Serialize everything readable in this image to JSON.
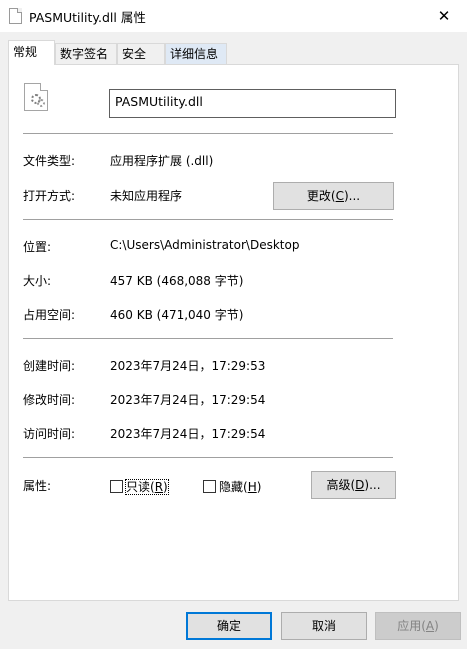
{
  "window": {
    "title": "PASMUtility.dll 属性",
    "close_glyph": "✕"
  },
  "tabs": [
    {
      "label": "常规",
      "active": true
    },
    {
      "label": "数字签名",
      "active": false
    },
    {
      "label": "安全",
      "active": false
    },
    {
      "label": "详细信息",
      "active": false
    }
  ],
  "general": {
    "file_name": "PASMUtility.dll",
    "file_type_label": "文件类型:",
    "file_type_value": "应用程序扩展 (.dll)",
    "opens_with_label": "打开方式:",
    "opens_with_value": "未知应用程序",
    "change_button": {
      "prefix": "更改(",
      "key": "C",
      "suffix": ")..."
    },
    "location_label": "位置:",
    "location_value": "C:\\Users\\Administrator\\Desktop",
    "size_label": "大小:",
    "size_value": "457 KB (468,088 字节)",
    "size_on_disk_label": "占用空间:",
    "size_on_disk_value": "460 KB (471,040 字节)",
    "created_label": "创建时间:",
    "created_value": "2023年7月24日，17:29:53",
    "modified_label": "修改时间:",
    "modified_value": "2023年7月24日，17:29:54",
    "accessed_label": "访问时间:",
    "accessed_value": "2023年7月24日，17:29:54",
    "attributes_label": "属性:",
    "readonly": {
      "prefix": "只读(",
      "key": "R",
      "suffix": ")",
      "checked": false
    },
    "hidden": {
      "prefix": "隐藏(",
      "key": "H",
      "suffix": ")",
      "checked": false
    },
    "advanced_button": {
      "prefix": "高级(",
      "key": "D",
      "suffix": ")..."
    }
  },
  "footer": {
    "ok_label": "确定",
    "cancel_label": "取消",
    "apply_prefix": "应用(",
    "apply_key": "A",
    "apply_suffix": ")"
  },
  "colors": {
    "focus_border": "#0078d7",
    "panel_bg": "#ffffff",
    "dialog_bg": "#f0f0f0"
  }
}
